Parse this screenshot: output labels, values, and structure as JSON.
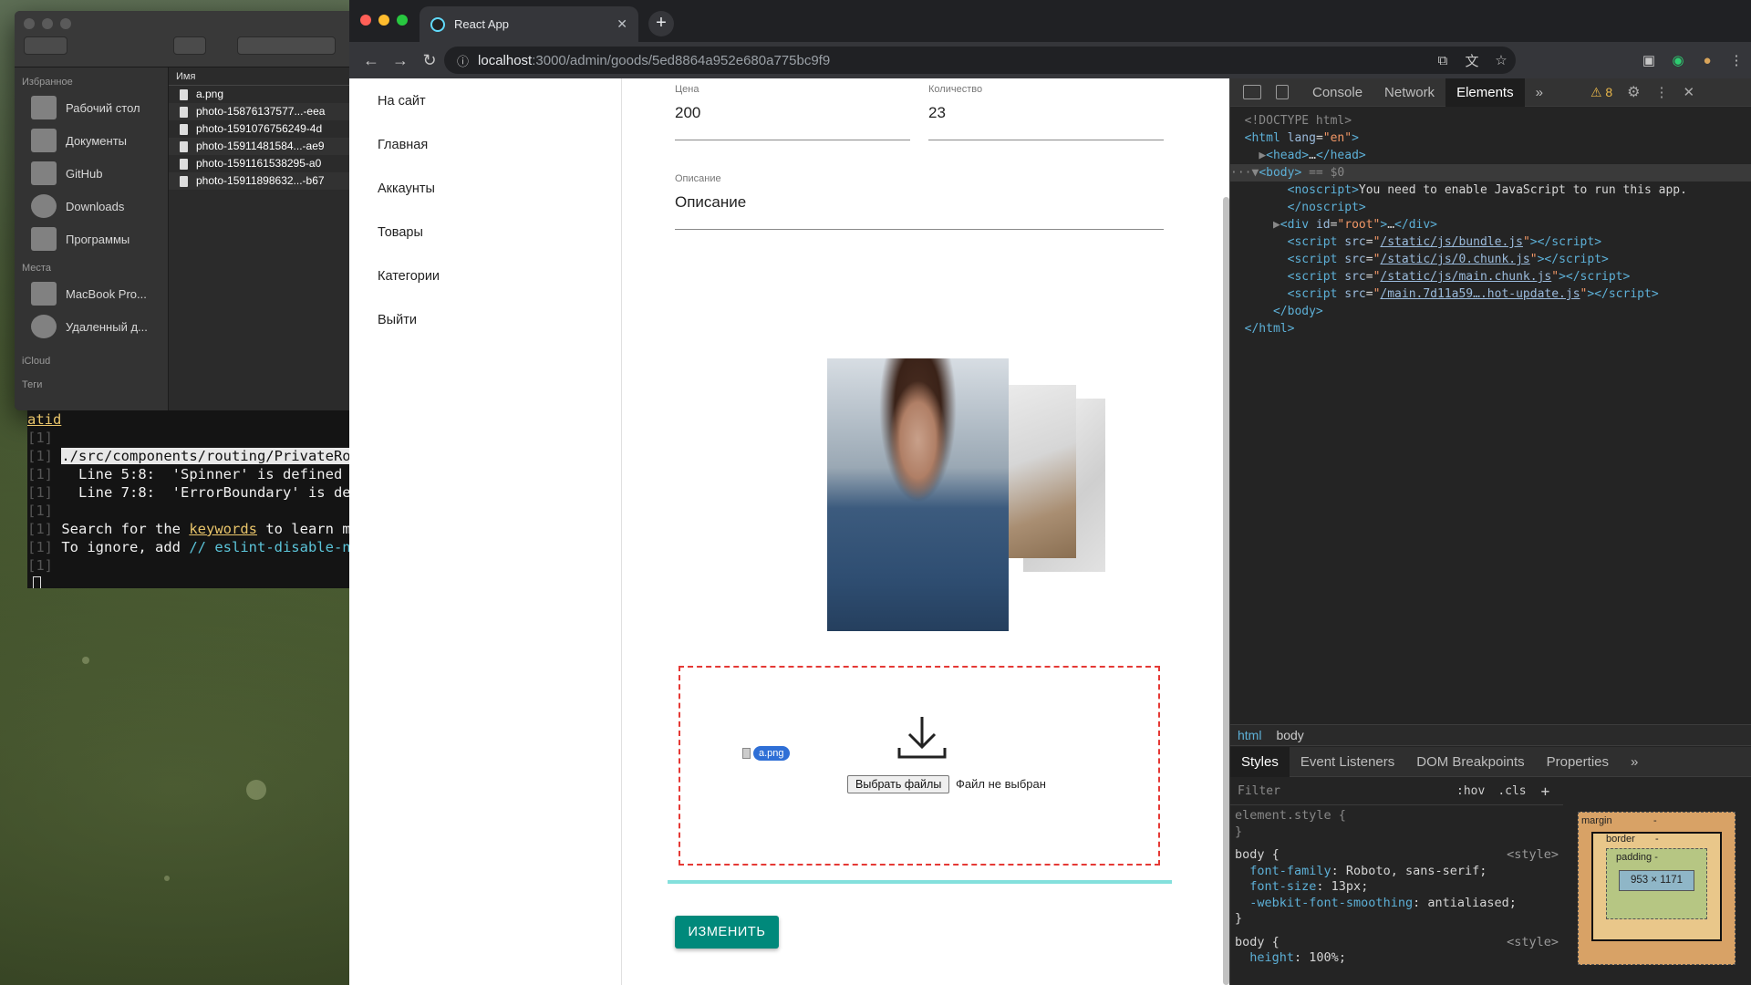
{
  "finder": {
    "sidebar_sections": {
      "favorites": "Избранное",
      "places": "Места",
      "icloud": "iCloud",
      "tags": "Теги"
    },
    "favorites": [
      "Рабочий стол",
      "Документы",
      "GitHub",
      "Downloads",
      "Программы"
    ],
    "places": [
      "MacBook Pro...",
      "Удаленный д..."
    ],
    "column_header": "Имя",
    "files": [
      "a.png",
      "photo-15876137577...-eea",
      "photo-1591076756249-4d",
      "photo-15911481584...-ae9",
      "photo-1591161538295-a0",
      "photo-15911898632...-b67"
    ]
  },
  "terminal": {
    "lines": [
      {
        "num": "",
        "text": "atid"
      },
      {
        "num": "[1]",
        "text": ""
      },
      {
        "num": "[1]",
        "text": "./src/components/routing/PrivateRo",
        "highlight": true
      },
      {
        "num": "[1]",
        "text": "  Line 5:8:  'Spinner' is defined "
      },
      {
        "num": "[1]",
        "text": "  Line 7:8:  'ErrorBoundary' is de"
      },
      {
        "num": "[1]",
        "text": ""
      },
      {
        "num": "[1]",
        "text": "Search for the keywords to learn m"
      },
      {
        "num": "[1]",
        "text": "To ignore, add // eslint-disable-n"
      },
      {
        "num": "[1]",
        "text": ""
      }
    ],
    "keyword": "keywords",
    "comment": "// eslint-disable-n"
  },
  "browser": {
    "tab_title": "React App",
    "tab_close": "✕",
    "new_tab": "+",
    "url_host": "localhost",
    "url_path": ":3000/admin/goods/5ed8864a952e680a775bc9f9"
  },
  "page": {
    "nav": [
      "На сайт",
      "Главная",
      "Аккаунты",
      "Товары",
      "Категории",
      "Выйти"
    ],
    "price_label": "Цена",
    "price_value": "200",
    "qty_label": "Количество",
    "qty_value": "23",
    "desc_label": "Описание",
    "desc_value": "Описание",
    "choose_files": "Выбрать файлы",
    "no_file": "Файл не выбран",
    "dragged_file": "a.png",
    "submit": "ИЗМЕНИТЬ"
  },
  "devtools": {
    "tabs": [
      "Console",
      "Network",
      "Elements"
    ],
    "active_tab": "Elements",
    "more": "»",
    "warnings": "⚠ 8",
    "breadcrumbs": [
      "html",
      "body"
    ],
    "style_tabs": [
      "Styles",
      "Event Listeners",
      "DOM Breakpoints",
      "Properties"
    ],
    "filter_placeholder": "Filter",
    "hov": ":hov",
    "cls": ".cls",
    "box_model": {
      "margin": "margin",
      "border": "border",
      "padding": "padding -",
      "dash": "-",
      "content": "953 × 1171"
    }
  },
  "colors": {
    "accent": "#00897b",
    "dropzone_border": "#e53935",
    "progress": "#84e0dc"
  }
}
